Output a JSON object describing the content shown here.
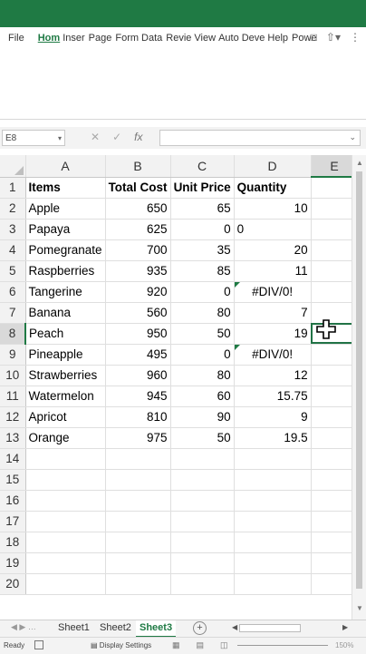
{
  "menu": {
    "tabs": [
      "File",
      "Hom",
      "Inser",
      "Page",
      "Form",
      "Data",
      "Revie",
      "View",
      "Auto",
      "Deve",
      "Help",
      "Powe"
    ],
    "active_index": 1
  },
  "formula_bar": {
    "name_box": "E8",
    "fx": "fx",
    "cancel_icon": "x-icon",
    "enter_icon": "check-icon"
  },
  "sheet": {
    "columns": [
      "A",
      "B",
      "C",
      "D",
      "E"
    ],
    "selected_column": "E",
    "selected_row": 8,
    "rows": [
      {
        "n": "1",
        "a": "Items",
        "b": "Total Cost",
        "c": "Unit Price",
        "d": "Quantity"
      },
      {
        "n": "2",
        "a": "Apple",
        "b": "650",
        "c": "65",
        "d": "10"
      },
      {
        "n": "3",
        "a": "Papaya",
        "b": "625",
        "c": "0",
        "d": "0"
      },
      {
        "n": "4",
        "a": "Pomegranate",
        "b": "700",
        "c": "35",
        "d": "20"
      },
      {
        "n": "5",
        "a": "Raspberries",
        "b": "935",
        "c": "85",
        "d": "11"
      },
      {
        "n": "6",
        "a": "Tangerine",
        "b": "920",
        "c": "0",
        "d": "#DIV/0!"
      },
      {
        "n": "7",
        "a": "Banana",
        "b": "560",
        "c": "80",
        "d": "7"
      },
      {
        "n": "8",
        "a": "Peach",
        "b": "950",
        "c": "50",
        "d": "19"
      },
      {
        "n": "9",
        "a": "Pineapple",
        "b": "495",
        "c": "0",
        "d": "#DIV/0!"
      },
      {
        "n": "10",
        "a": "Strawberries",
        "b": "960",
        "c": "80",
        "d": "12"
      },
      {
        "n": "11",
        "a": "Watermelon",
        "b": "945",
        "c": "60",
        "d": "15.75"
      },
      {
        "n": "12",
        "a": "Apricot",
        "b": "810",
        "c": "90",
        "d": "9"
      },
      {
        "n": "13",
        "a": "Orange",
        "b": "975",
        "c": "50",
        "d": "19.5"
      },
      {
        "n": "14",
        "a": "",
        "b": "",
        "c": "",
        "d": ""
      },
      {
        "n": "15",
        "a": "",
        "b": "",
        "c": "",
        "d": ""
      },
      {
        "n": "16",
        "a": "",
        "b": "",
        "c": "",
        "d": ""
      },
      {
        "n": "17",
        "a": "",
        "b": "",
        "c": "",
        "d": ""
      },
      {
        "n": "18",
        "a": "",
        "b": "",
        "c": "",
        "d": ""
      },
      {
        "n": "19",
        "a": "",
        "b": "",
        "c": "",
        "d": ""
      },
      {
        "n": "20",
        "a": "",
        "b": "",
        "c": "",
        "d": ""
      }
    ]
  },
  "sheet_tabs": [
    "Sheet1",
    "Sheet2",
    "Sheet3"
  ],
  "active_sheet": "Sheet3",
  "status": {
    "ready": "Ready",
    "display_settings": "Display Settings",
    "zoom": "150%"
  },
  "colors": {
    "accent": "#1f7a44"
  }
}
